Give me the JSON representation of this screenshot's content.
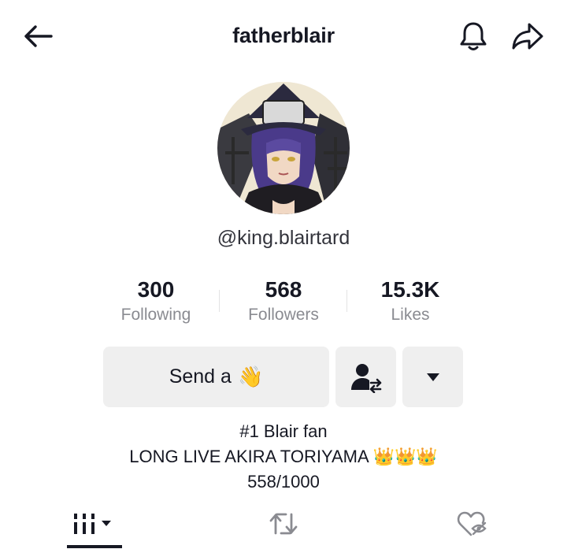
{
  "header": {
    "title": "fatherblair",
    "back_icon": "arrow-left-icon",
    "bell_icon": "bell-icon",
    "share_icon": "share-arrow-icon"
  },
  "profile": {
    "avatar_description_icon": "avatar",
    "handle": "@king.blairtard"
  },
  "stats": [
    {
      "value": "300",
      "label": "Following"
    },
    {
      "value": "568",
      "label": "Followers"
    },
    {
      "value": "15.3K",
      "label": "Likes"
    }
  ],
  "actions": {
    "send_label": "Send a",
    "send_emoji": "👋",
    "follow_icon": "person-swap-icon",
    "more_icon": "caret-down-icon"
  },
  "bio": {
    "line1": "#1 Blair fan",
    "line2": "LONG LIVE AKIRA TORIYAMA 👑👑👑",
    "line3": "558/1000"
  },
  "tabs": [
    {
      "icon": "videos-grid-icon"
    },
    {
      "icon": "repost-icon"
    },
    {
      "icon": "liked-hidden-icon"
    }
  ],
  "colors": {
    "text": "#161823",
    "muted": "#8a8b91",
    "button_bg": "#efefef"
  }
}
